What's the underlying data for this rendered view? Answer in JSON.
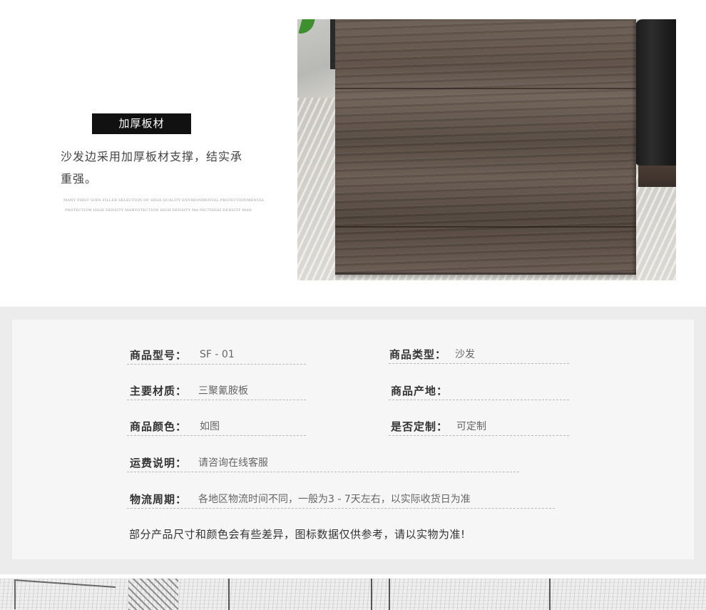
{
  "feature": {
    "tag": "加厚板材",
    "description": "沙发边采用加厚板材支撑，结实承重强。",
    "english_line1": "MANY FIRST SOFA FILLER SELECTION OF HIGH QUALITY ENVIRONMENTAL PROTECTIONMENTAL",
    "english_line2": "PROTECTION HIGH DENSITY MANYOTECTION HIGH DENSITY MA PECTHIGH DENSITY MAN"
  },
  "specs": {
    "model_label": "商品型号：",
    "model_value": "SF - 01",
    "type_label": "商品类型：",
    "type_value": "沙发",
    "material_label": "主要材质：",
    "material_value": "三聚氰胺板",
    "origin_label": "商品产地：",
    "origin_value": "",
    "color_label": "商品颜色：",
    "color_value": "如图",
    "custom_label": "是否定制：",
    "custom_value": "可定制",
    "shipping_label": "运费说明：",
    "shipping_value": "请咨询在线客服",
    "logistics_label": "物流周期：",
    "logistics_value": "各地区物流时间不同，一般为3 -  7天左右，以实际收货日为准"
  },
  "note": "部分产品尺寸和颜色会有些差异，图标数据仅供参考，请以实物为准!"
}
